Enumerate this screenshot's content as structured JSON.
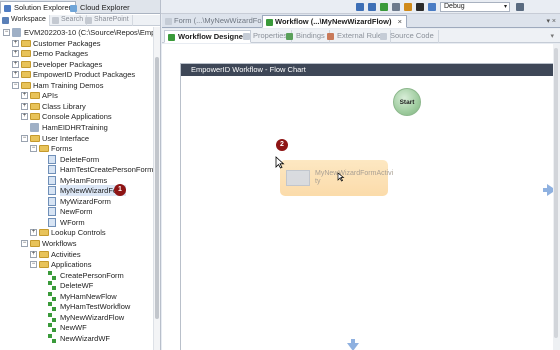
{
  "toolbar": {
    "config_value": "Debug",
    "config_caret": "▾",
    "tools": [
      "save-icon",
      "save-all-icon",
      "check-icon",
      "settings-icon",
      "clock-icon",
      "stop-icon",
      "bookmark-icon",
      "window-icon"
    ],
    "tool_colors": [
      "#3d6fb6",
      "#3d6fb6",
      "#3a9a3a",
      "#6d7a8c",
      "#d08a1a",
      "#2b2b2b",
      "#4a7cc4",
      "#5a6b80"
    ]
  },
  "left_panel": {
    "tabs": [
      "Solution Explorer",
      "Cloud Explorer"
    ],
    "subtabs": [
      "Workspace",
      "Search",
      "SharePoint"
    ],
    "tree": [
      {
        "label": "EVM202203-10 (C:\\Source\\Repos\\EmpowerID",
        "depth": 0,
        "kind": "ref",
        "exp": "−"
      },
      {
        "label": "Customer Packages",
        "depth": 1,
        "kind": "folder",
        "exp": "+"
      },
      {
        "label": "Demo Packages",
        "depth": 1,
        "kind": "folder",
        "exp": "+"
      },
      {
        "label": "Developer Packages",
        "depth": 1,
        "kind": "folder",
        "exp": "+"
      },
      {
        "label": "EmpowerID Product Packages",
        "depth": 1,
        "kind": "folder",
        "exp": "+"
      },
      {
        "label": "Ham Training Demos",
        "depth": 1,
        "kind": "folder",
        "exp": "−"
      },
      {
        "label": "APIs",
        "depth": 2,
        "kind": "folder",
        "exp": "+"
      },
      {
        "label": "Class Library",
        "depth": 2,
        "kind": "folder",
        "exp": "+"
      },
      {
        "label": "Console Applications",
        "depth": 2,
        "kind": "folder",
        "exp": "+"
      },
      {
        "label": "HamEIDHRTraining",
        "depth": 2,
        "kind": "ref",
        "exp": ""
      },
      {
        "label": "User Interface",
        "depth": 2,
        "kind": "folder",
        "exp": "−"
      },
      {
        "label": "Forms",
        "depth": 3,
        "kind": "folder",
        "exp": "−"
      },
      {
        "label": "DeleteForm",
        "depth": 4,
        "kind": "file",
        "exp": ""
      },
      {
        "label": "HamTestCreatePersonForm",
        "depth": 4,
        "kind": "file",
        "exp": ""
      },
      {
        "label": "MyHamForms",
        "depth": 4,
        "kind": "file",
        "exp": ""
      },
      {
        "label": "MyNewWizardForm",
        "depth": 4,
        "kind": "file",
        "exp": "",
        "selected": true
      },
      {
        "label": "MyWizardForm",
        "depth": 4,
        "kind": "file",
        "exp": ""
      },
      {
        "label": "NewForm",
        "depth": 4,
        "kind": "file",
        "exp": ""
      },
      {
        "label": "WForm",
        "depth": 4,
        "kind": "file",
        "exp": ""
      },
      {
        "label": "Lookup Controls",
        "depth": 3,
        "kind": "folder",
        "exp": "+"
      },
      {
        "label": "Workflows",
        "depth": 2,
        "kind": "folder",
        "exp": "−"
      },
      {
        "label": "Activities",
        "depth": 3,
        "kind": "folder",
        "exp": "+"
      },
      {
        "label": "Applications",
        "depth": 3,
        "kind": "folder",
        "exp": "−"
      },
      {
        "label": "CreatePersonForm",
        "depth": 4,
        "kind": "wf",
        "exp": ""
      },
      {
        "label": "DeleteWF",
        "depth": 4,
        "kind": "wf",
        "exp": ""
      },
      {
        "label": "MyHamNewFlow",
        "depth": 4,
        "kind": "wf",
        "exp": ""
      },
      {
        "label": "MyHamTestWorkflow",
        "depth": 4,
        "kind": "wf",
        "exp": ""
      },
      {
        "label": "MyNewWizardFlow",
        "depth": 4,
        "kind": "wf",
        "exp": ""
      },
      {
        "label": "NewWF",
        "depth": 4,
        "kind": "wf",
        "exp": ""
      },
      {
        "label": "NewWizardWF",
        "depth": 4,
        "kind": "wf",
        "exp": ""
      }
    ],
    "badge_1": "1"
  },
  "doc_tabs": {
    "inactive": "Form (...\\MyNewWizardForm)",
    "active": "Workflow (...\\MyNewWizardFlow)",
    "close": "×",
    "menu": "▾ ×"
  },
  "sub_tabs": [
    "Workflow Designer",
    "Properties",
    "Bindings",
    "External Rules",
    "Source Code"
  ],
  "sub_tabs_more": "▾",
  "designer": {
    "title": "EmpowerID Workflow - Flow Chart",
    "start_label": "Start",
    "activity_text": "MyNewWizardFormActivi ty",
    "badge_2": "2"
  },
  "colors": {
    "title_bar": "#3e4757",
    "activity": "#fbd69c",
    "badge": "#8e1414",
    "start_node": "#9fcc9f",
    "nav_arrows": "#8fb1e0"
  }
}
